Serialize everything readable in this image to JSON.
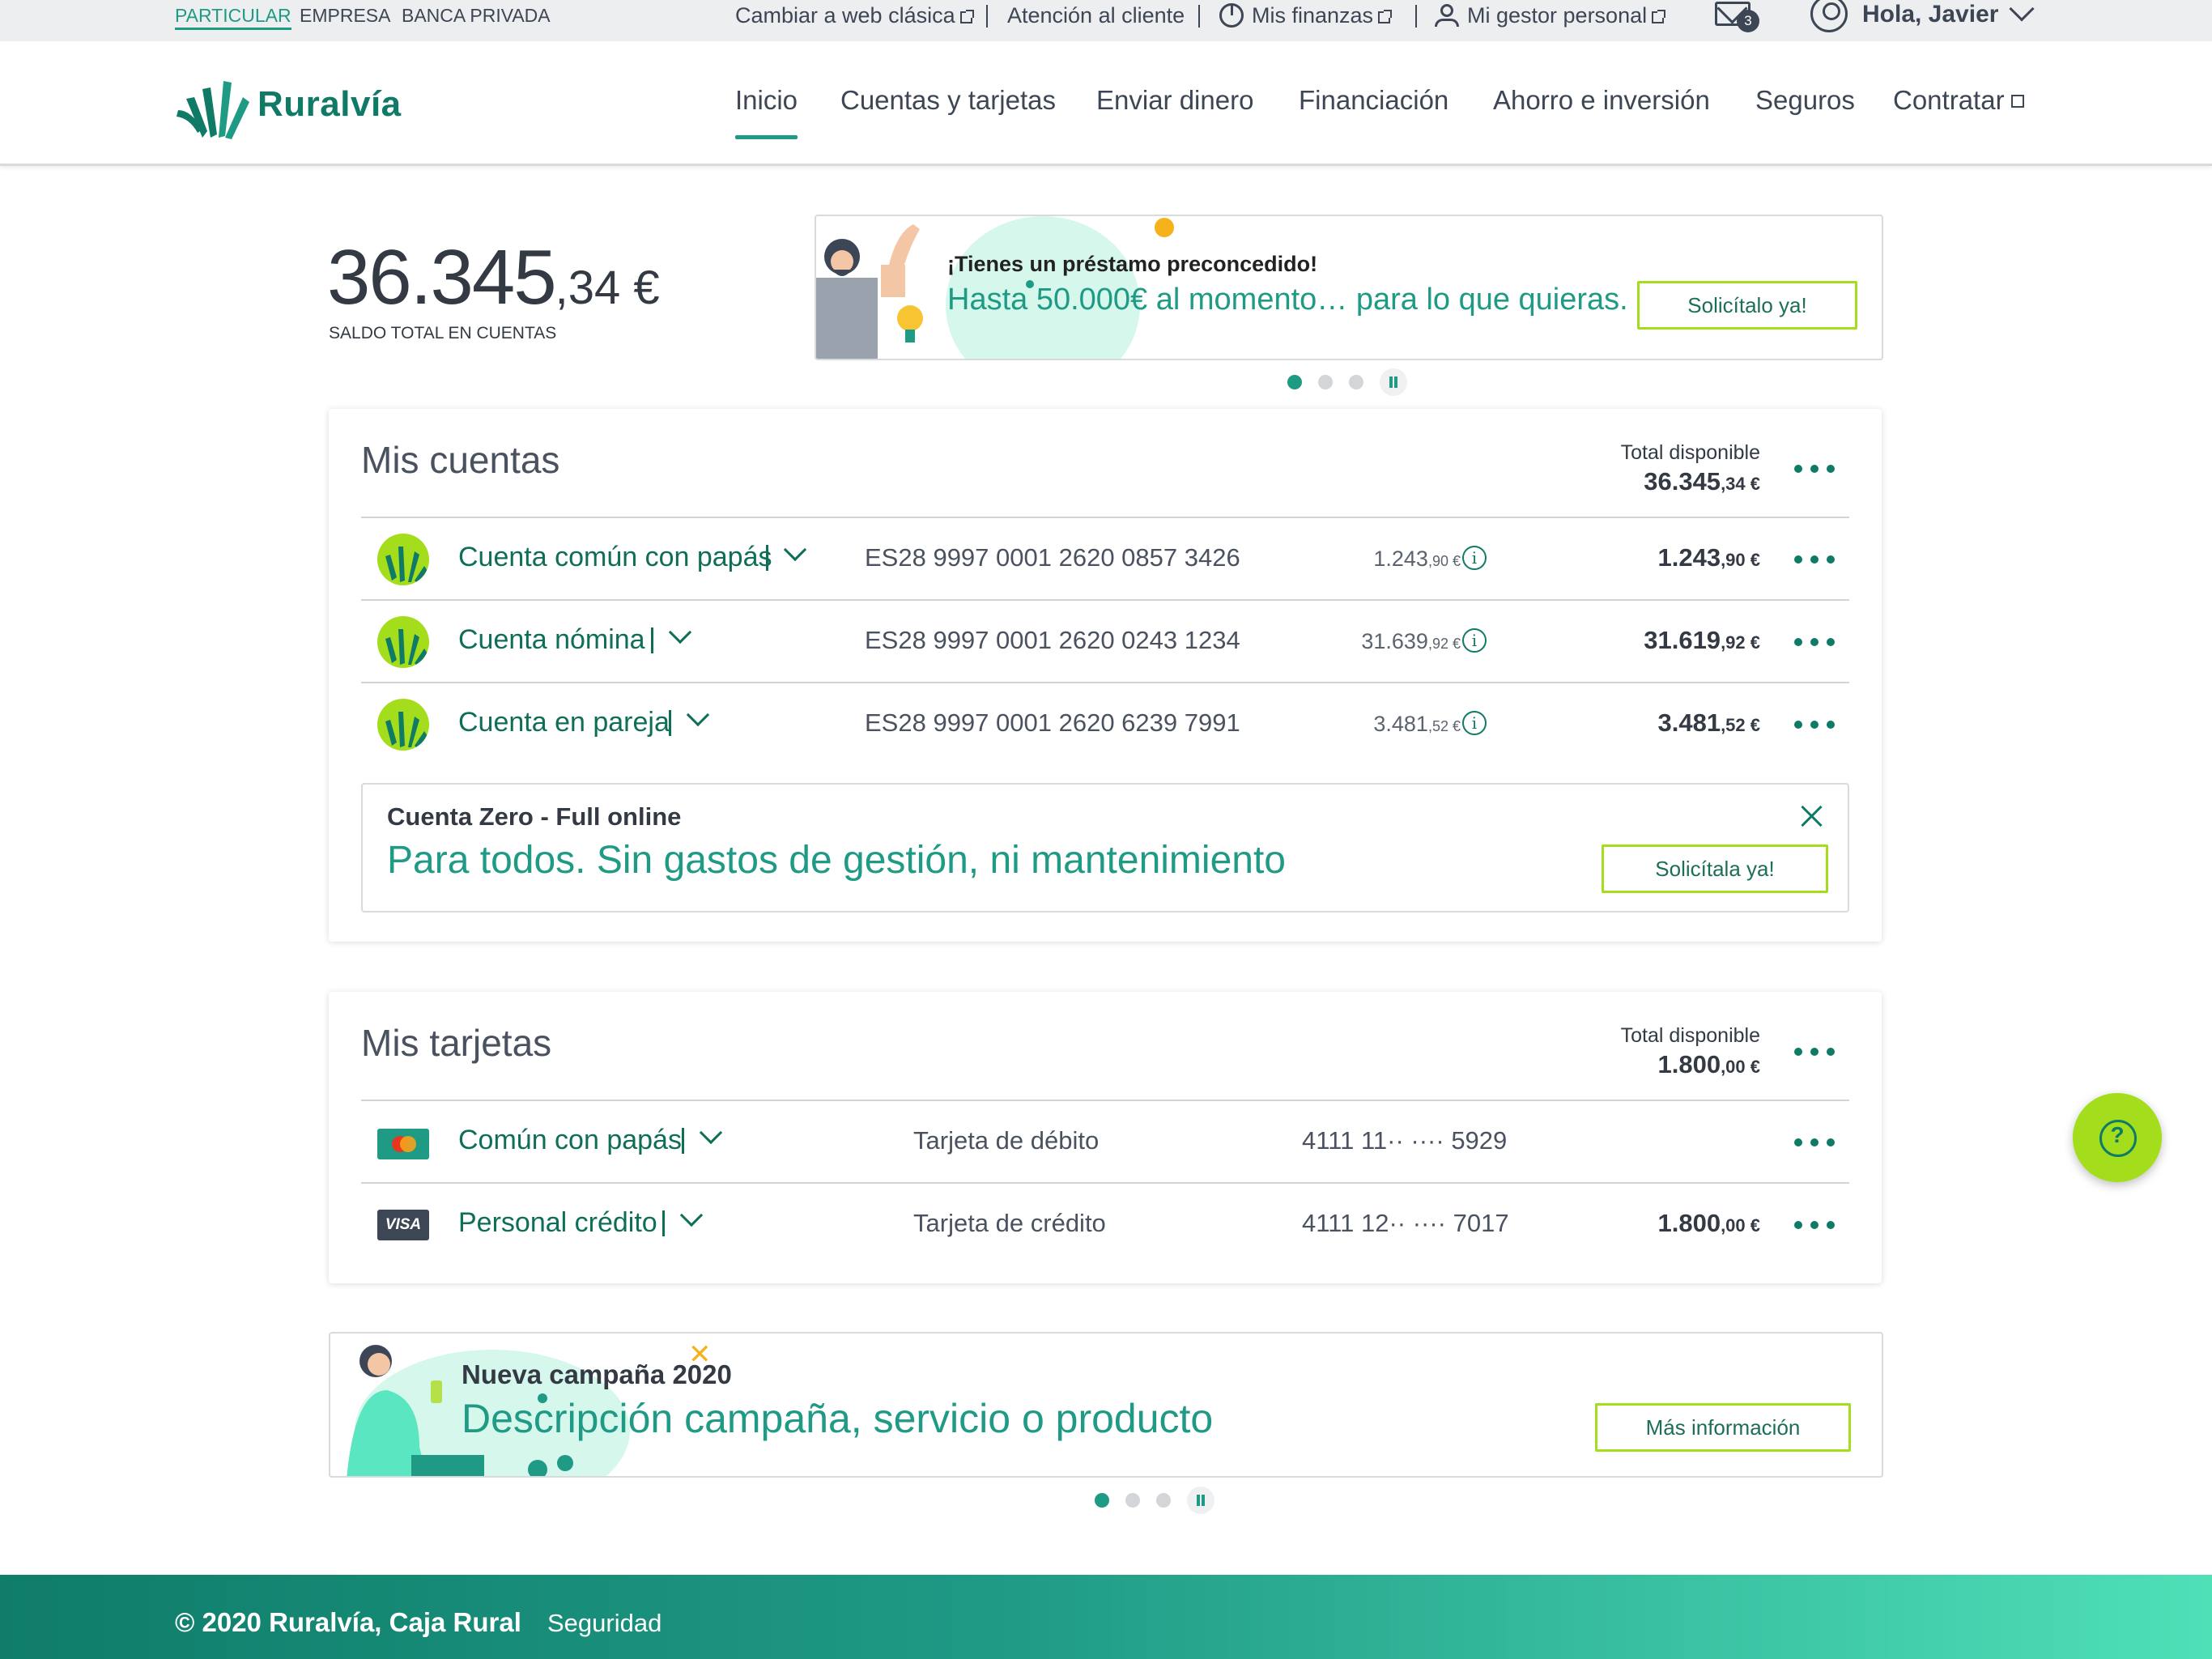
{
  "segments": [
    "PARTICULAR",
    "EMPRESA",
    "BANCA PRIVADA"
  ],
  "utility": {
    "classic_web": "Cambiar a web clásica",
    "support": "Atención al cliente",
    "finances": "Mis finanzas",
    "manager": "Mi gestor personal",
    "mail_count": "3",
    "greeting": "Hola, Javier"
  },
  "brand": {
    "name": "Ruralvía"
  },
  "nav": {
    "items": [
      "Inicio",
      "Cuentas y tarjetas",
      "Enviar dinero",
      "Financiación",
      "Ahorro e inversión",
      "Seguros",
      "Contratar"
    ],
    "active": "Inicio"
  },
  "balance": {
    "integer": "36.345",
    "decimal": ",34 €",
    "label": "SALDO TOTAL EN CUENTAS"
  },
  "loan_promo": {
    "title": "¡Tienes un préstamo preconcedido!",
    "subtitle": "Hasta 50.000€ al momento… para lo que quieras.",
    "button": "Solicítalo ya!"
  },
  "accounts": {
    "title": "Mis cuentas",
    "total_label": "Total disponible",
    "total_int": "36.345",
    "total_dec": ",34 €",
    "rows": [
      {
        "name": "Cuenta común con papás",
        "iban": "ES28 9997 0001 2620 0857 3426",
        "sub_int": "1.243",
        "sub_dec": ",90 €",
        "amt_int": "1.243",
        "amt_dec": ",90 €"
      },
      {
        "name": "Cuenta nómina",
        "iban": "ES28 9997 0001 2620 0243 1234",
        "sub_int": "31.639",
        "sub_dec": ",92 €",
        "amt_int": "31.619",
        "amt_dec": ",92 €"
      },
      {
        "name": "Cuenta en pareja",
        "iban": "ES28 9997 0001 2620 6239 7991",
        "sub_int": "3.481",
        "sub_dec": ",52 €",
        "amt_int": "3.481",
        "amt_dec": ",52 €"
      }
    ],
    "promo": {
      "title": "Cuenta Zero - Full online",
      "subtitle": "Para todos. Sin gastos de gestión, ni mantenimiento",
      "button": "Solicítala ya!"
    }
  },
  "cards": {
    "title": "Mis tarjetas",
    "total_label": "Total disponible",
    "total_int": "1.800",
    "total_dec": ",00 €",
    "rows": [
      {
        "name": "Común con papás",
        "type": "Tarjeta de débito",
        "number": "4111 11·· ···· 5929",
        "brand": "mastercard",
        "amt_int": "",
        "amt_dec": ""
      },
      {
        "name": "Personal crédito",
        "type": "Tarjeta de crédito",
        "number": "4111 12·· ···· 7017",
        "brand": "VISA",
        "amt_int": "1.800",
        "amt_dec": ",00 €"
      }
    ]
  },
  "campaign": {
    "title": "Nueva campaña 2020",
    "subtitle": "Descripción campaña, servicio o producto",
    "button": "Más información"
  },
  "footer": {
    "copyright": "© 2020 Ruralvía, Caja Rural",
    "link": "Seguridad"
  },
  "colors": {
    "brand_green": "#1f9a85",
    "dark_green": "#0f7a66",
    "lime": "#a3dd1b"
  }
}
